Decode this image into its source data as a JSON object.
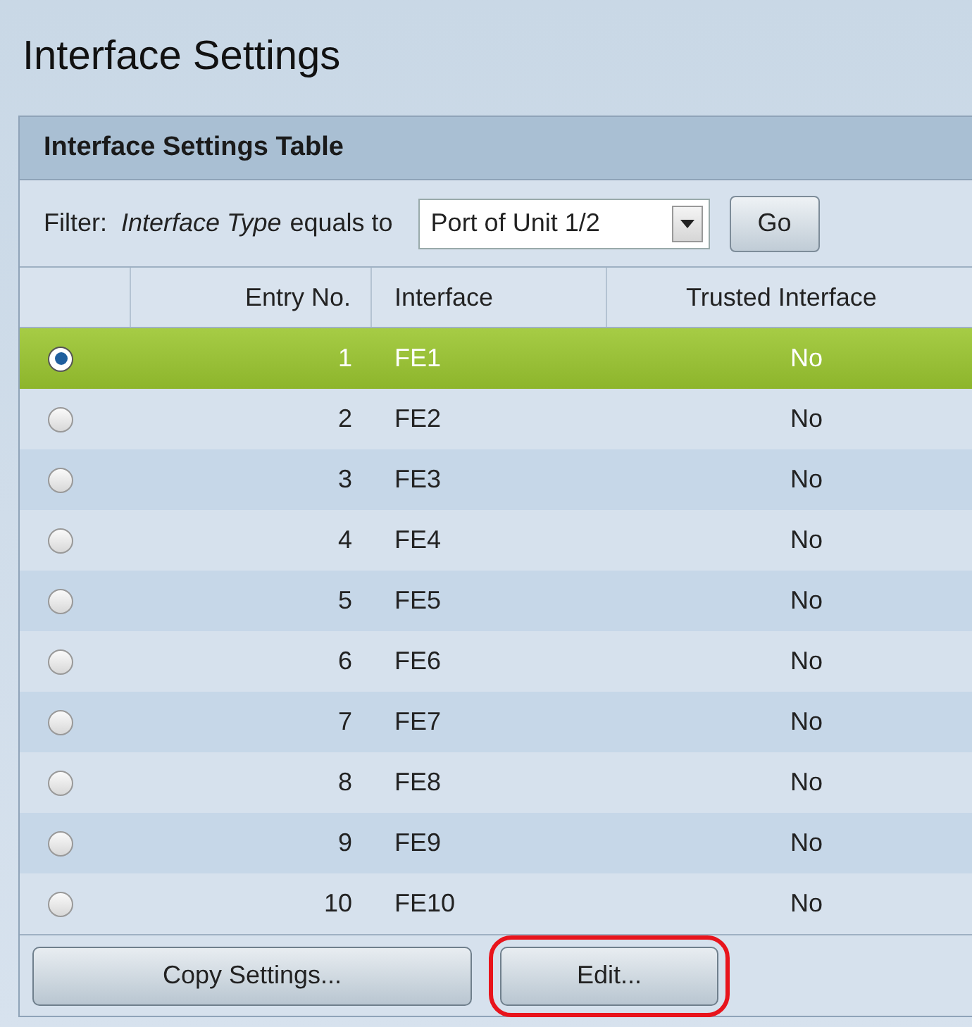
{
  "page_title": "Interface Settings",
  "table": {
    "title": "Interface Settings Table",
    "filter": {
      "label": "Filter:",
      "field": "Interface Type",
      "operator": "equals to",
      "select_value": "Port of Unit 1/2",
      "go_button": "Go"
    },
    "columns": [
      "Entry No.",
      "Interface",
      "Trusted Interface"
    ],
    "rows": [
      {
        "entry": "1",
        "interface": "FE1",
        "trusted": "No",
        "selected": true
      },
      {
        "entry": "2",
        "interface": "FE2",
        "trusted": "No",
        "selected": false
      },
      {
        "entry": "3",
        "interface": "FE3",
        "trusted": "No",
        "selected": false
      },
      {
        "entry": "4",
        "interface": "FE4",
        "trusted": "No",
        "selected": false
      },
      {
        "entry": "5",
        "interface": "FE5",
        "trusted": "No",
        "selected": false
      },
      {
        "entry": "6",
        "interface": "FE6",
        "trusted": "No",
        "selected": false
      },
      {
        "entry": "7",
        "interface": "FE7",
        "trusted": "No",
        "selected": false
      },
      {
        "entry": "8",
        "interface": "FE8",
        "trusted": "No",
        "selected": false
      },
      {
        "entry": "9",
        "interface": "FE9",
        "trusted": "No",
        "selected": false
      },
      {
        "entry": "10",
        "interface": "FE10",
        "trusted": "No",
        "selected": false
      }
    ],
    "buttons": [
      {
        "label": "Copy Settings...",
        "highlighted": false
      },
      {
        "label": "Edit...",
        "highlighted": true
      }
    ]
  }
}
